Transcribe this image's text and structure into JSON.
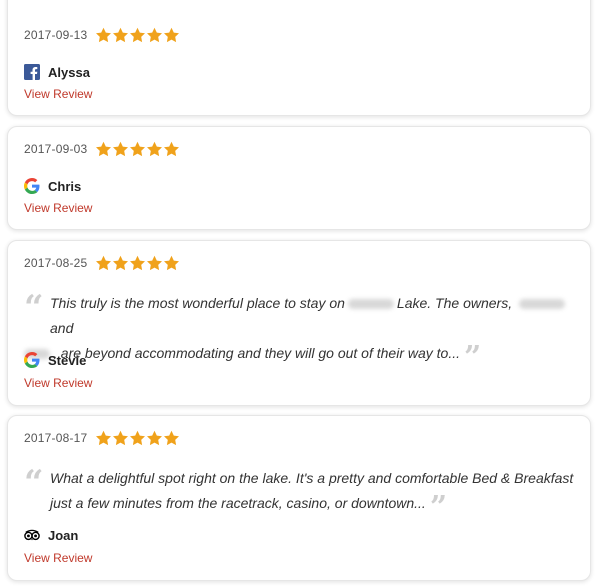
{
  "reviews": [
    {
      "date": "2017-09-13",
      "rating": 5,
      "source": "facebook",
      "source_icon": "facebook-icon",
      "author": "Alyssa",
      "link": "View Review"
    },
    {
      "date": "2017-09-03",
      "rating": 5,
      "source": "google",
      "source_icon": "google-icon",
      "author": "Chris",
      "link": "View Review"
    },
    {
      "date": "2017-08-25",
      "rating": 5,
      "source": "google",
      "source_icon": "google-icon",
      "author": "Stevie",
      "link": "View Review",
      "text_parts": [
        "This truly is the most wonderful place to stay on",
        "Lake. The owners,",
        "and",
        ", are beyond accommodating and they will go out of their way to..."
      ]
    },
    {
      "date": "2017-08-17",
      "rating": 5,
      "source": "tripadvisor",
      "source_icon": "tripadvisor-owl-icon",
      "author": "Joan",
      "link": "View Review",
      "text": "What a delightful spot right on the lake. It's a pretty and comfortable Bed & Breakfast just a few minutes from the racetrack, casino, or downtown..."
    }
  ],
  "colors": {
    "star": "#f0a21b",
    "link": "#c0392b",
    "quote_mark": "#cfcfcf"
  }
}
